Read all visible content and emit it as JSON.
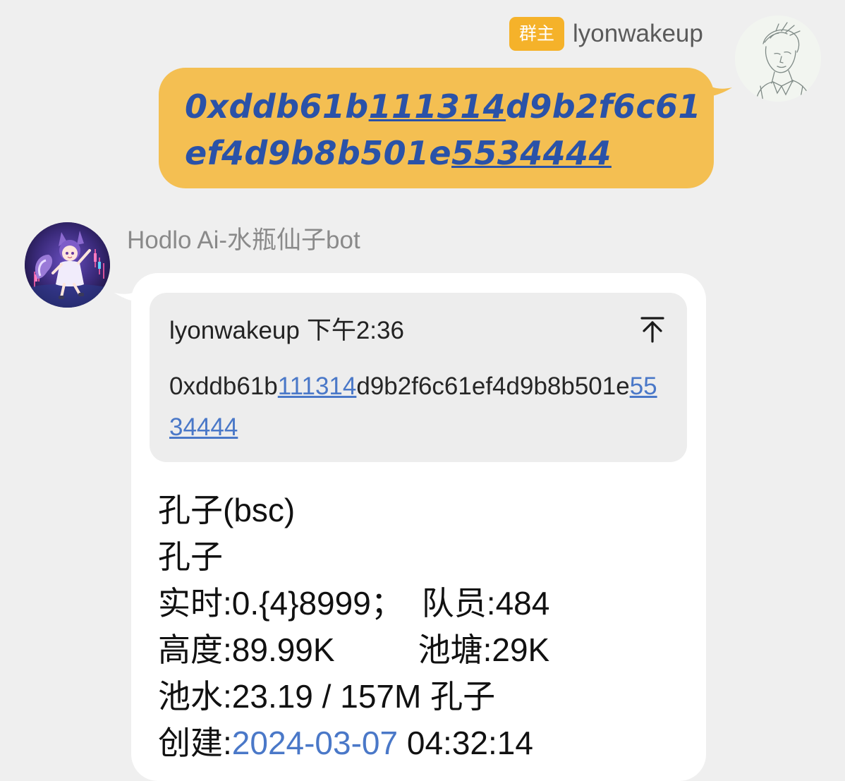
{
  "outgoing": {
    "badge": "群主",
    "sender": "lyonwakeup",
    "message_parts": [
      "0xddb61b",
      "111314",
      "d9b2f6c61ef4d9b8b501e",
      "5534444"
    ]
  },
  "incoming": {
    "bot_name": "Hodlo Ai-水瓶仙子bot",
    "quote": {
      "author": "lyonwakeup",
      "time": "下午2:36",
      "text_parts": [
        "0xddb61b",
        "111314",
        "d9b2f6c61ef4d9b8b501e",
        "5534444"
      ]
    },
    "reply": {
      "title": "孔子(bsc)",
      "name": "孔子",
      "realtime_label": "实时:0.{4}8999；",
      "members": "队员:484",
      "height": "高度:89.99K",
      "pool": "池塘:29K",
      "liquidity": "池水:23.19 / 157M 孔子",
      "created_label": "创建:",
      "created_date": "2024-03-07",
      "created_time": "04:32:14"
    }
  },
  "colors": {
    "background": "#efefef",
    "outgoing_bubble": "#f4bf52",
    "badge": "#f5b22a",
    "link": "#4a78c8",
    "outgoing_text": "#2a52a8",
    "quote_bg": "#ededed"
  },
  "icons": {
    "quote_jump": "arrow-up-to-line-icon",
    "avatar_user": "sketch-portrait-avatar",
    "avatar_bot": "anime-fox-girl-avatar"
  }
}
